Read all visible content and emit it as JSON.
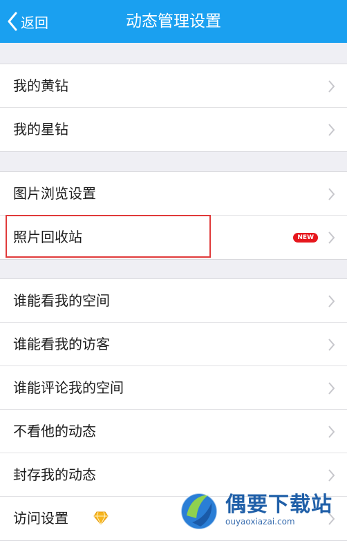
{
  "header": {
    "back_label": "返回",
    "title": "动态管理设置"
  },
  "groups": [
    {
      "items": [
        {
          "label": "我的黄钻"
        },
        {
          "label": "我的星钻"
        }
      ]
    },
    {
      "items": [
        {
          "label": "图片浏览设置"
        },
        {
          "label": "照片回收站",
          "badge": "NEW"
        }
      ]
    },
    {
      "items": [
        {
          "label": "谁能看我的空间"
        },
        {
          "label": "谁能看我的访客"
        },
        {
          "label": "谁能评论我的空间"
        },
        {
          "label": "不看他的动态"
        },
        {
          "label": "封存我的动态"
        },
        {
          "label": "访问设置",
          "icon": "diamond-icon"
        }
      ]
    }
  ],
  "watermark": {
    "title": "偶要下载站",
    "url": "ouyaoxiazai.com"
  },
  "colors": {
    "nav_bg": "#1aa0f0",
    "badge": "#e6171d",
    "highlight": "#e03a3a"
  }
}
